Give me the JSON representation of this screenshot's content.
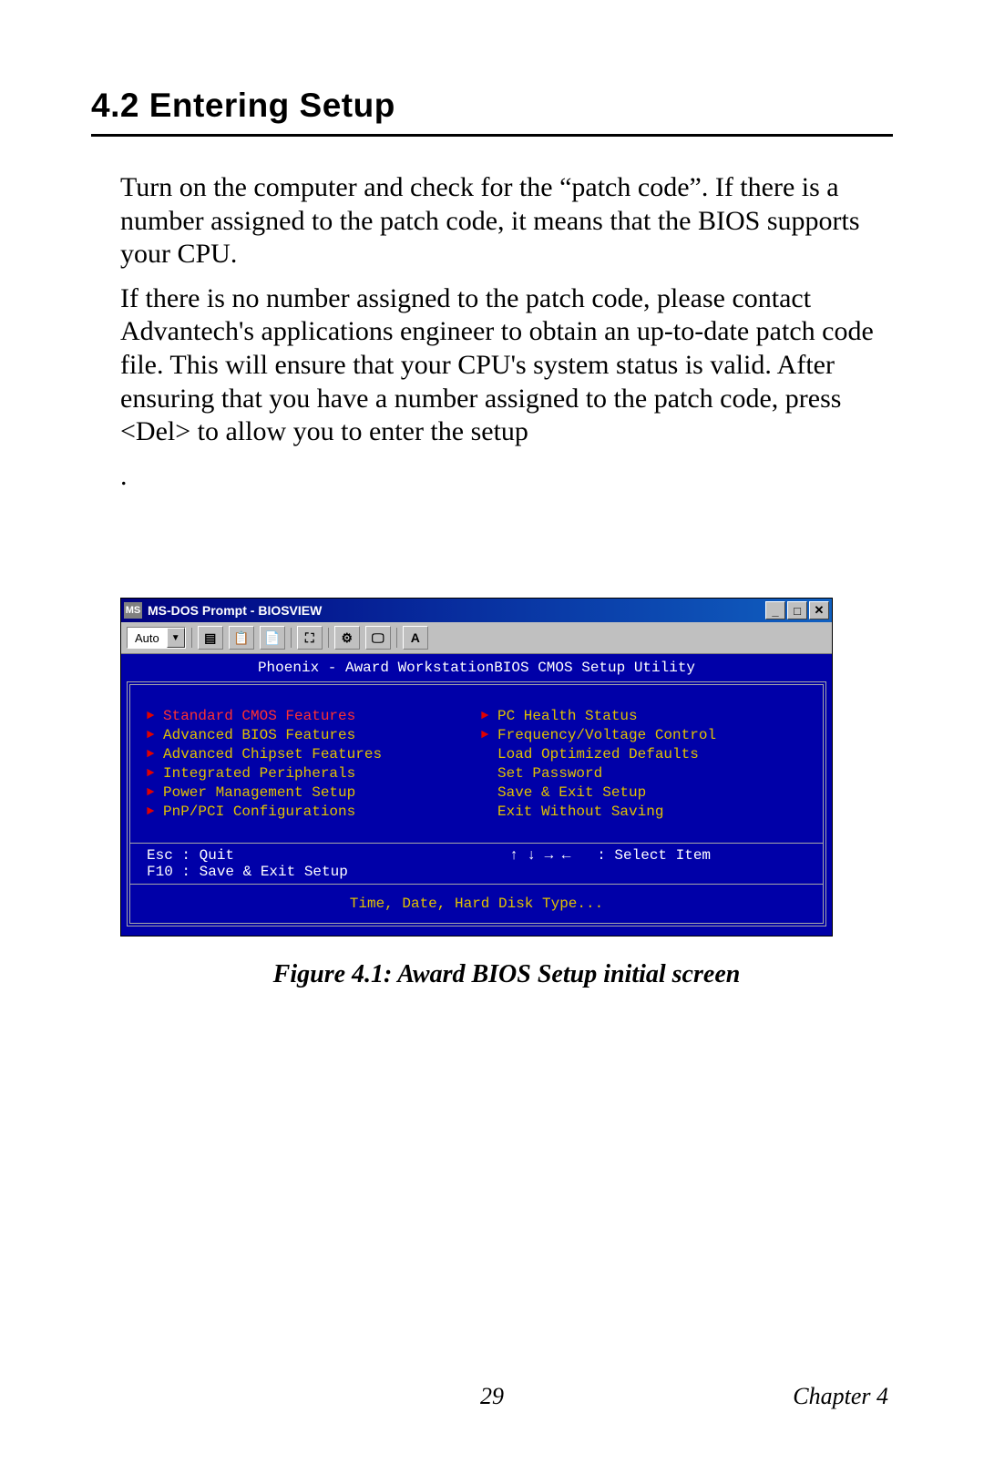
{
  "heading": "4.2  Entering Setup",
  "paragraphs": [
    "Turn on the computer and check for the “patch code”. If there is a number assigned to the patch code, it means that the BIOS supports your CPU.",
    "If there is no number assigned to the patch code, please contact Advantech's applications engineer to obtain an up-to-date patch code file. This will ensure that your CPU's system status is valid. After ensuring that you have a number assigned to the patch code, press <Del> to allow you to enter the setup",
    "."
  ],
  "window": {
    "title": "MS-DOS Prompt - BIOSVIEW",
    "dropdown_value": "Auto",
    "toolbar_font_label": "A"
  },
  "bios": {
    "header": "Phoenix - Award WorkstationBIOS CMOS Setup Utility",
    "left_menu": [
      {
        "label": "Standard CMOS Features",
        "arrow": true,
        "selected": true
      },
      {
        "label": "Advanced BIOS Features",
        "arrow": true,
        "selected": false
      },
      {
        "label": "Advanced Chipset Features",
        "arrow": true,
        "selected": false
      },
      {
        "label": "Integrated Peripherals",
        "arrow": true,
        "selected": false
      },
      {
        "label": "Power Management Setup",
        "arrow": true,
        "selected": false
      },
      {
        "label": "PnP/PCI Configurations",
        "arrow": true,
        "selected": false
      }
    ],
    "right_menu": [
      {
        "label": "PC Health Status",
        "arrow": true,
        "selected": false
      },
      {
        "label": "Frequency/Voltage Control",
        "arrow": true,
        "selected": false
      },
      {
        "label": "Load Optimized Defaults",
        "arrow": false,
        "selected": false
      },
      {
        "label": "Set Password",
        "arrow": false,
        "selected": false
      },
      {
        "label": "Save & Exit Setup",
        "arrow": false,
        "selected": false
      },
      {
        "label": "Exit Without Saving",
        "arrow": false,
        "selected": false
      }
    ],
    "help_left": "Esc : Quit\nF10 : Save & Exit Setup",
    "help_right": "↑ ↓ → ←   : Select Item",
    "description": "Time, Date, Hard Disk Type..."
  },
  "figure_caption": "Figure 4.1: Award BIOS Setup initial screen",
  "footer": {
    "page_number": "29",
    "chapter": "Chapter 4"
  }
}
